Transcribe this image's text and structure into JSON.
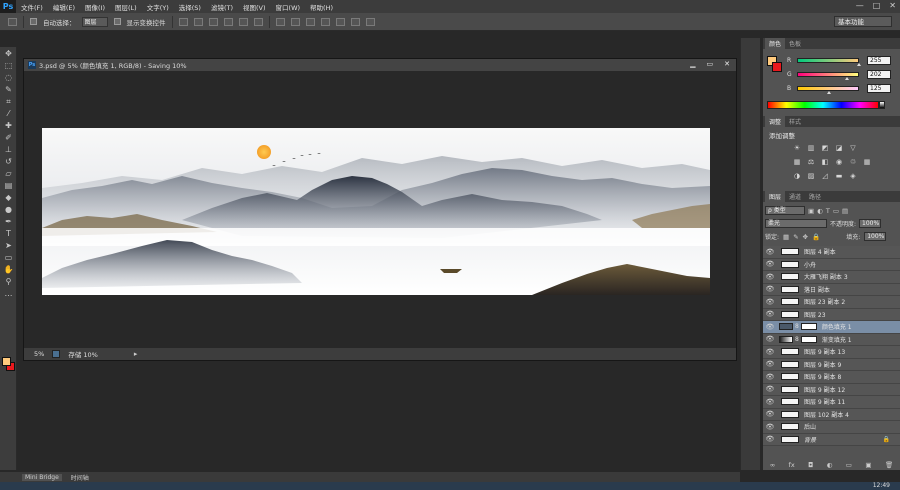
{
  "app": {
    "logo": "Ps"
  },
  "menu": [
    "文件(F)",
    "编辑(E)",
    "图像(I)",
    "图层(L)",
    "文字(Y)",
    "选择(S)",
    "滤镜(T)",
    "视图(V)",
    "窗口(W)",
    "帮助(H)"
  ],
  "window_controls": {
    "minimize": "—",
    "maximize": "□",
    "close": "✕"
  },
  "options_bar": {
    "auto_select_label": "自动选择：",
    "auto_select_value": "图层",
    "show_transform_label": "显示变换控件",
    "workspace": "基本功能"
  },
  "document": {
    "title": "3.psd @ 5% (颜色填充 1, RGB/8) - Saving 10%",
    "zoom": "5%",
    "status_text": "存储 10%",
    "save_progress": 10
  },
  "color_panel": {
    "tabs": [
      "颜色",
      "色板"
    ],
    "r": 255,
    "g": 202,
    "b": 125,
    "fg_color": "#ffca7d",
    "bg_color": "#e8181d"
  },
  "adjustments_panel": {
    "tabs": [
      "调整",
      "样式"
    ],
    "title": "添加调整"
  },
  "layers_panel": {
    "tabs": [
      "图层",
      "通道",
      "路径"
    ],
    "filter": "ρ 类型",
    "blend_mode": "柔光",
    "opacity_label": "不透明度:",
    "opacity": "100%",
    "lock_label": "锁定:",
    "fill_label": "填充:",
    "fill": "100%",
    "layers": [
      {
        "name": "图层 4 副本",
        "selected": false
      },
      {
        "name": "小舟",
        "selected": false
      },
      {
        "name": "大雁飞翔 副本 3",
        "selected": false
      },
      {
        "name": "落日 副本",
        "selected": false
      },
      {
        "name": "图层 23 副本 2",
        "selected": false
      },
      {
        "name": "图层 23",
        "selected": false
      },
      {
        "name": "颜色填充 1",
        "selected": true
      },
      {
        "name": "渐变填充 1",
        "selected": false
      },
      {
        "name": "图层 9 副本 13",
        "selected": false
      },
      {
        "name": "图层 9 副本 9",
        "selected": false
      },
      {
        "name": "图层 9 副本 8",
        "selected": false
      },
      {
        "name": "图层 9 副本 12",
        "selected": false
      },
      {
        "name": "图层 9 副本 11",
        "selected": false
      },
      {
        "name": "图层 102 副本 4",
        "selected": false
      },
      {
        "name": "后山",
        "selected": false
      },
      {
        "name": "背景",
        "selected": false
      }
    ],
    "footer_icons": [
      "link-icon",
      "fx-icon",
      "mask-icon",
      "adjustment-icon",
      "group-icon",
      "new-layer-icon",
      "trash-icon"
    ]
  },
  "bottom_tabs": [
    "Mini Bridge",
    "时间轴"
  ],
  "taskbar": {
    "clock": "12:49"
  }
}
